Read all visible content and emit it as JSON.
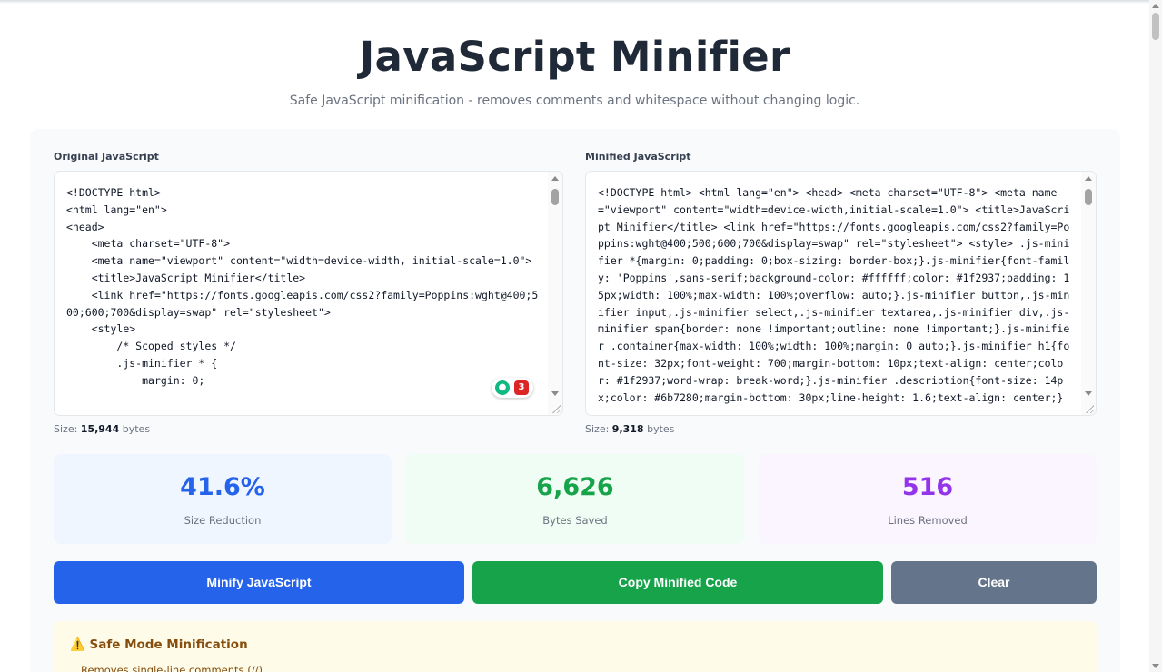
{
  "header": {
    "title": "JavaScript Minifier",
    "subtitle": "Safe JavaScript minification - removes comments and whitespace without changing logic."
  },
  "original": {
    "label": "Original JavaScript",
    "code": "<!DOCTYPE html>\n<html lang=\"en\">\n<head>\n    <meta charset=\"UTF-8\">\n    <meta name=\"viewport\" content=\"width=device-width, initial-scale=1.0\">\n    <title>JavaScript Minifier</title>\n    <link href=\"https://fonts.googleapis.com/css2?family=Poppins:wght@400;500;600;700&display=swap\" rel=\"stylesheet\">\n    <style>\n        /* Scoped styles */\n        .js-minifier * {\n            margin: 0;",
    "size_prefix": "Size:",
    "size_value": "15,944",
    "size_unit": "bytes"
  },
  "minified": {
    "label": "Minified JavaScript",
    "code": "<!DOCTYPE html> <html lang=\"en\"> <head> <meta charset=\"UTF-8\"> <meta name=\"viewport\" content=\"width=device-width,initial-scale=1.0\"> <title>JavaScript Minifier</title> <link href=\"https://fonts.googleapis.com/css2?family=Poppins:wght@400;500;600;700&display=swap\" rel=\"stylesheet\"> <style> .js-minifier *{margin: 0;padding: 0;box-sizing: border-box;}.js-minifier{font-family: 'Poppins',sans-serif;background-color: #ffffff;color: #1f2937;padding: 15px;width: 100%;max-width: 100%;overflow: auto;}.js-minifier button,.js-minifier input,.js-minifier select,.js-minifier textarea,.js-minifier div,.js-minifier span{border: none !important;outline: none !important;}.js-minifier .container{max-width: 100%;width: 100%;margin: 0 auto;}.js-minifier h1{font-size: 32px;font-weight: 700;margin-bottom: 10px;text-align: center;color: #1f2937;word-wrap: break-word;}.js-minifier .description{font-size: 14px;color: #6b7280;margin-bottom: 30px;line-height: 1.6;text-align: center;}",
    "size_prefix": "Size:",
    "size_value": "9,318",
    "size_unit": "bytes"
  },
  "extension_badge": {
    "icon": "lightbulb-icon",
    "count": "3"
  },
  "stats": [
    {
      "value": "41.6%",
      "caption": "Size Reduction",
      "color": "#2563eb",
      "bg": "#eff6ff"
    },
    {
      "value": "6,626",
      "caption": "Bytes Saved",
      "color": "#16a34a",
      "bg": "#f0fdf4"
    },
    {
      "value": "516",
      "caption": "Lines Removed",
      "color": "#9333ea",
      "bg": "#faf5ff"
    }
  ],
  "buttons": {
    "minify": "Minify JavaScript",
    "copy": "Copy Minified Code",
    "clear": "Clear"
  },
  "colors": {
    "blue": "#2563eb",
    "green": "#16a34a",
    "gray": "#64748b"
  },
  "notice": {
    "title": "⚠️ Safe Mode Minification",
    "item": "Removes single-line comments (//)"
  }
}
